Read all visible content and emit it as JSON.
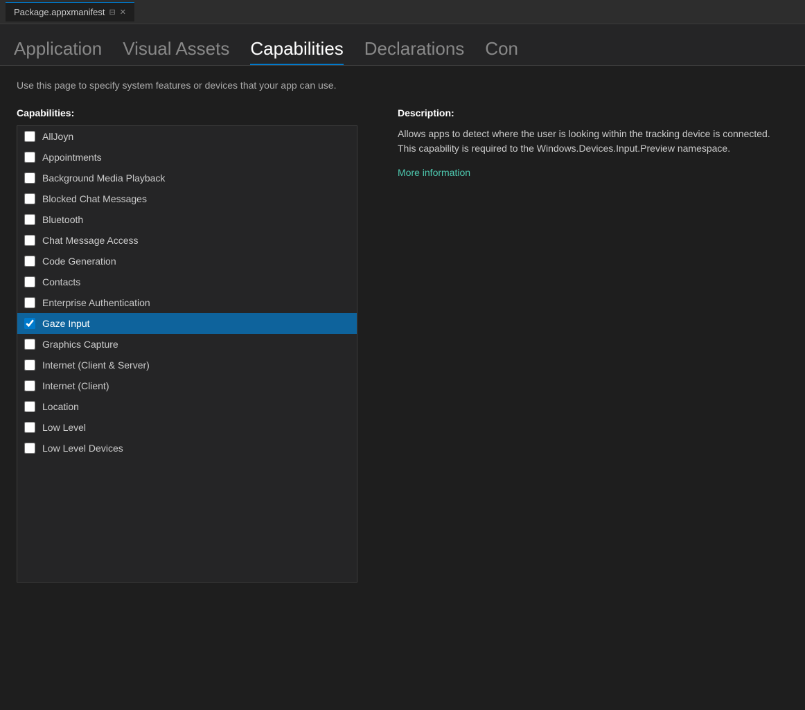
{
  "titleBar": {
    "tabLabel": "Package.appxmanifest",
    "pinIcon": "⊟",
    "closeIcon": "✕"
  },
  "navTabs": [
    {
      "id": "application",
      "label": "Application",
      "active": false
    },
    {
      "id": "visual-assets",
      "label": "Visual Assets",
      "active": false
    },
    {
      "id": "capabilities",
      "label": "Capabilities",
      "active": true
    },
    {
      "id": "declarations",
      "label": "Declarations",
      "active": false
    },
    {
      "id": "con",
      "label": "Con",
      "active": false
    }
  ],
  "pageDescription": "Use this page to specify system features or devices that your app can use.",
  "capabilitiesLabel": "Capabilities:",
  "descriptionLabel": "Description:",
  "descriptionText": "Allows apps to detect where the user is looking within the tracking device is connected. This capability is required to the Windows.Devices.Input.Preview namespace.",
  "moreInfoLink": "More information",
  "capabilities": [
    {
      "id": "alljoyn",
      "label": "AllJoyn",
      "checked": false,
      "selected": false
    },
    {
      "id": "appointments",
      "label": "Appointments",
      "checked": false,
      "selected": false
    },
    {
      "id": "background-media-playback",
      "label": "Background Media Playback",
      "checked": false,
      "selected": false
    },
    {
      "id": "blocked-chat-messages",
      "label": "Blocked Chat Messages",
      "checked": false,
      "selected": false
    },
    {
      "id": "bluetooth",
      "label": "Bluetooth",
      "checked": false,
      "selected": false
    },
    {
      "id": "chat-message-access",
      "label": "Chat Message Access",
      "checked": false,
      "selected": false
    },
    {
      "id": "code-generation",
      "label": "Code Generation",
      "checked": false,
      "selected": false
    },
    {
      "id": "contacts",
      "label": "Contacts",
      "checked": false,
      "selected": false
    },
    {
      "id": "enterprise-authentication",
      "label": "Enterprise Authentication",
      "checked": false,
      "selected": false
    },
    {
      "id": "gaze-input",
      "label": "Gaze Input",
      "checked": true,
      "selected": true
    },
    {
      "id": "graphics-capture",
      "label": "Graphics Capture",
      "checked": false,
      "selected": false
    },
    {
      "id": "internet-client-server",
      "label": "Internet (Client & Server)",
      "checked": false,
      "selected": false
    },
    {
      "id": "internet-client",
      "label": "Internet (Client)",
      "checked": false,
      "selected": false
    },
    {
      "id": "location",
      "label": "Location",
      "checked": false,
      "selected": false
    },
    {
      "id": "low-level",
      "label": "Low Level",
      "checked": false,
      "selected": false
    },
    {
      "id": "low-level-devices",
      "label": "Low Level Devices",
      "checked": false,
      "selected": false
    }
  ]
}
